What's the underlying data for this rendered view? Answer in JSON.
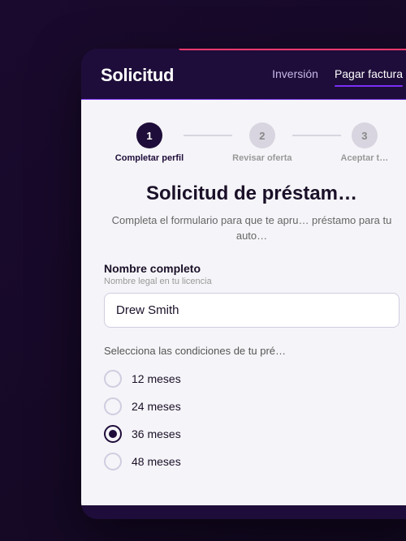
{
  "app": {
    "title": "Solicitud",
    "nav": {
      "items": [
        {
          "label": "Inversión",
          "active": false
        },
        {
          "label": "Pagar factura",
          "active": true
        }
      ]
    }
  },
  "stepper": {
    "steps": [
      {
        "number": "1",
        "label": "Completar perfil",
        "active": true
      },
      {
        "number": "2",
        "label": "Revisar oferta",
        "active": false
      },
      {
        "number": "3",
        "label": "Aceptar t…",
        "active": false
      }
    ]
  },
  "form": {
    "title": "Solicitud de préstam…",
    "subtitle": "Completa el formulario para que te apru…\npréstamo para tu auto…",
    "full_name_label": "Nombre completo",
    "full_name_hint": "Nombre legal en tu licencia",
    "full_name_value": "Drew Smith",
    "full_name_placeholder": "Drew Smith",
    "conditions_label": "Selecciona las condiciones de tu pré…",
    "radio_options": [
      {
        "label": "12 meses",
        "selected": false
      },
      {
        "label": "24 meses",
        "selected": false
      },
      {
        "label": "36 meses",
        "selected": true
      },
      {
        "label": "48 meses",
        "selected": false
      }
    ]
  },
  "colors": {
    "brand_dark": "#1e0d3a",
    "brand_purple": "#7b2ff7",
    "brand_red": "#ff3b6e"
  }
}
